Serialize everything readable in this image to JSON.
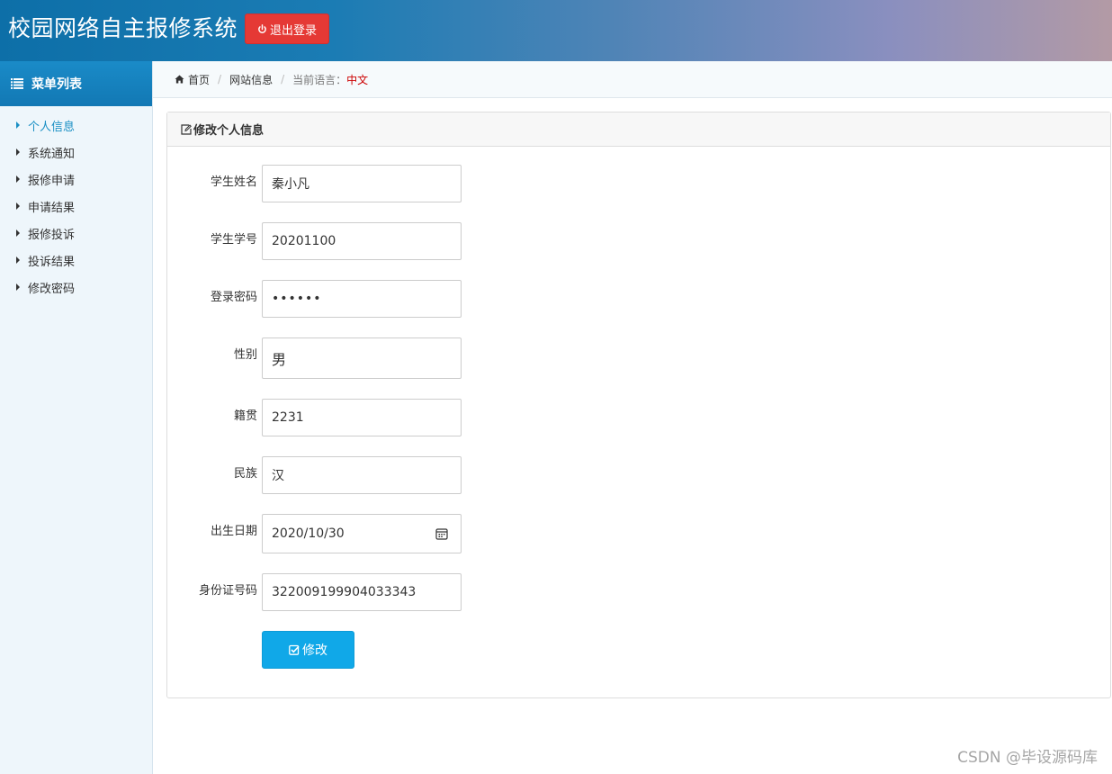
{
  "header": {
    "title": "校园网络自主报修系统",
    "logout_label": "退出登录",
    "accent": "#e53935"
  },
  "sidebar": {
    "menu_title": "菜单列表",
    "items": [
      {
        "label": "个人信息",
        "active": true
      },
      {
        "label": "系统通知"
      },
      {
        "label": "报修申请"
      },
      {
        "label": "申请结果"
      },
      {
        "label": "报修投诉"
      },
      {
        "label": "投诉结果"
      },
      {
        "label": "修改密码"
      }
    ]
  },
  "breadcrumb": {
    "home": "首页",
    "site": "网站信息",
    "lang_label": "当前语言：",
    "lang_value": "中文"
  },
  "panel": {
    "title": "修改个人信息",
    "fields": [
      {
        "label": "学生姓名",
        "value": "秦小凡"
      },
      {
        "label": "学生学号",
        "value": "20201100"
      },
      {
        "label": "登录密码",
        "value": "••••••"
      },
      {
        "label": "性别",
        "value": "男"
      },
      {
        "label": "籍贯",
        "value": "2231"
      },
      {
        "label": "民族",
        "value": "汉"
      },
      {
        "label": "出生日期",
        "value": "2020/10/30"
      },
      {
        "label": "身份证号码",
        "value": "322009199904033343"
      }
    ],
    "submit_label": "修改",
    "submit_color": "#10a8e8"
  },
  "watermark": "CSDN @毕设源码库",
  "icons": [
    "power-icon",
    "list-icon",
    "home-icon",
    "edit-icon",
    "calendar-icon",
    "check-square-icon"
  ]
}
